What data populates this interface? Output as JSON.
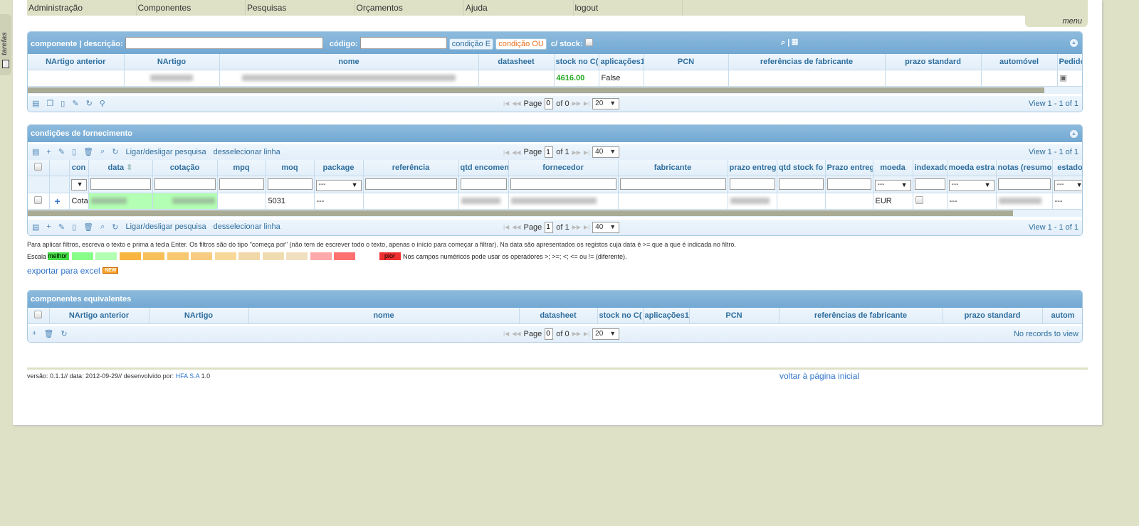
{
  "sidebar": {
    "tab_label": "tarefas"
  },
  "nav": {
    "items": [
      "Administração",
      "Componentes",
      "Pesquisas",
      "Orçamentos",
      "Ajuda",
      "logout"
    ],
    "menu_label": "menu"
  },
  "componente": {
    "title": "componente  | descrição:",
    "codigo_label": "código:",
    "descricao_value": "",
    "codigo_value": "",
    "cond_e": "condição E",
    "cond_ou": "condição OU",
    "stock_label": "c/ stock:",
    "columns": [
      "NArtigo anterior",
      "NArtigo",
      "nome",
      "datasheet",
      "stock no C(",
      "aplicações1",
      "PCN",
      "referências de fabricante",
      "prazo standard",
      "automóvel",
      "Pedido"
    ],
    "row": {
      "stock": "4616.00",
      "aplicacoes": "False"
    },
    "stock_color": "#22aa22",
    "pager": {
      "page_label": "Page",
      "page": "0",
      "of": "of 0",
      "rows": "20",
      "view": "View 1 - 1 of 1"
    }
  },
  "fornecimento": {
    "title": "condições de fornecimento",
    "tool_search": "Ligar/desligar pesquisa",
    "tool_deselect": "desselecionar linha",
    "columns": [
      "",
      "",
      "con",
      "data",
      "cotação",
      "mpq",
      "moq",
      "package",
      "referência",
      "qtd encomen",
      "fornecedor",
      "fabricante",
      "prazo entreg",
      "qtd stock fo",
      "Prazo entreg",
      "moeda",
      "indexado",
      "moeda estra",
      "notas (resumo",
      "estado"
    ],
    "filter_select_value": "---",
    "row": {
      "con": "Cota",
      "moq": "5031",
      "package": "---",
      "moeda": "EUR",
      "moeda_estra": "---",
      "estado": "---"
    },
    "highlight_color": "#b3ffb3",
    "pager": {
      "page_label": "Page",
      "page": "1",
      "of": "of 1",
      "rows": "40",
      "view": "View 1 - 1 of 1"
    }
  },
  "notes": {
    "filter_help": "Para aplicar filtros, escreva o texto e prima a tecla Enter. Os filtros são do tipo \"começa por\" (não tem de escrever todo o texto, apenas o início para começar a filtrar). Na data são apresentados os registos cuja data é >= que a que é indicada no filtro.",
    "scale_label": "Escala",
    "best": "melhor",
    "worst": "pior",
    "scale_colors": [
      "#44dd44",
      "#88ff88",
      "#b3ffb3",
      "#f8b540",
      "#f8c05a",
      "#f8c870",
      "#f8cc80",
      "#f8d898",
      "#f0d8a8",
      "#f0dcb0",
      "#f0e0c0",
      "#ffaaaa",
      "#ff7070",
      "#ee3030"
    ],
    "operators_help": "Nos campos numéricos pode usar os operadores >; >=; <; <= ou != (diferente).",
    "export": "exportar para excel",
    "new_badge": "NEW"
  },
  "equivalentes": {
    "title": "componentes equivalentes",
    "columns": [
      "",
      "NArtigo anterior",
      "NArtigo",
      "nome",
      "datasheet",
      "stock no C(",
      "aplicações1",
      "PCN",
      "referências de fabricante",
      "prazo standard",
      "autom"
    ],
    "pager": {
      "page_label": "Page",
      "page": "0",
      "of": "of 0",
      "rows": "20",
      "view": "No records to view"
    }
  },
  "footer": {
    "prefix": "versão: 0.1.1// data: 2012-09-29// desenvolvido por: ",
    "company": "HFA S.A",
    "suffix": " 1.0",
    "back": "voltar à página inicial"
  }
}
